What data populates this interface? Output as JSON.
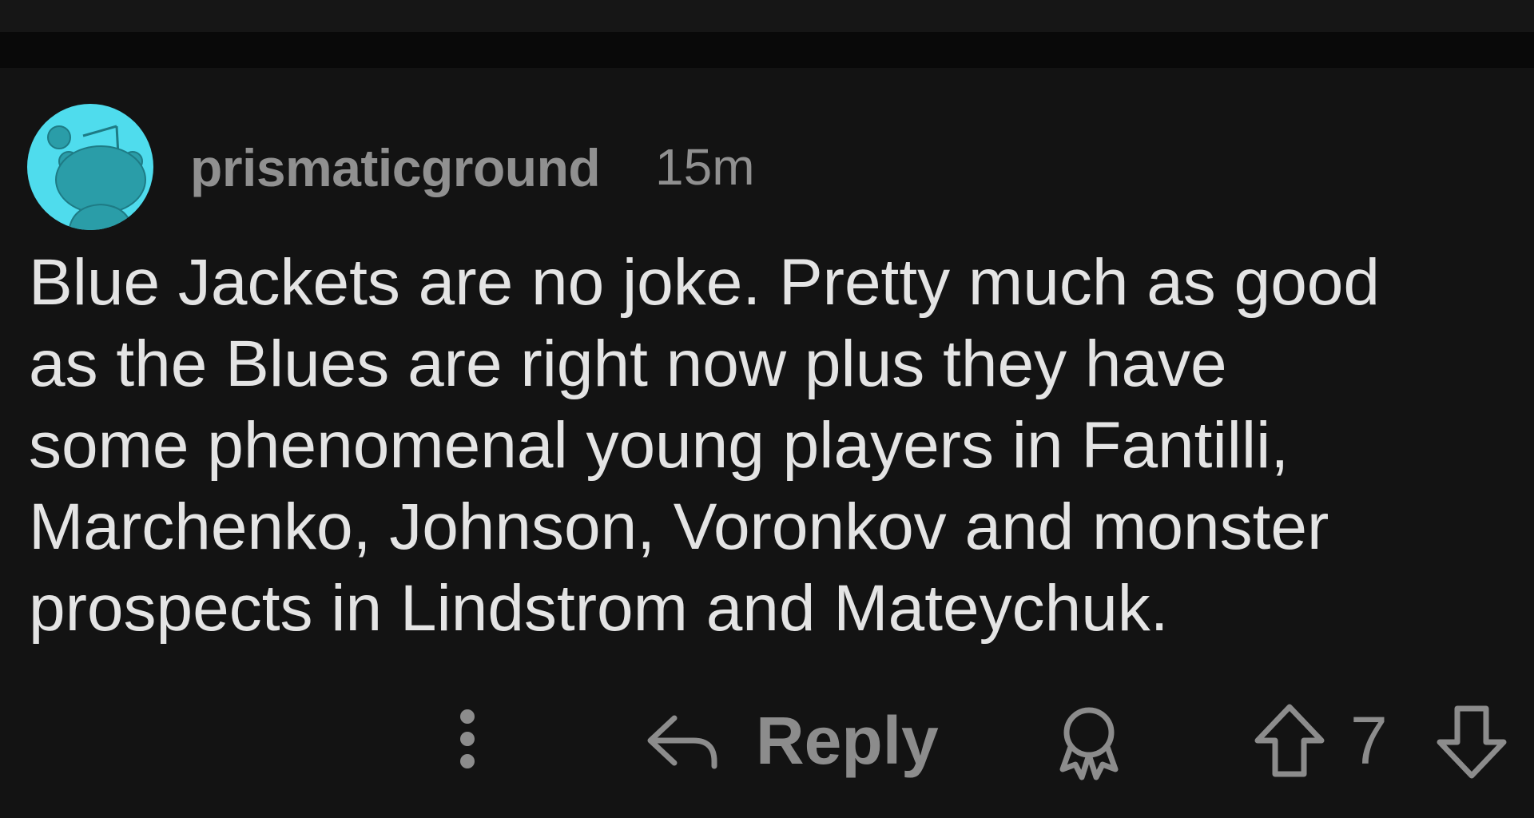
{
  "comment": {
    "username": "prismaticground",
    "timestamp": "15m",
    "body_lines": [
      "Blue Jackets are no joke. Pretty much as good",
      "as the Blues are right now plus they have",
      "some phenomenal young players in Fantilli,",
      "Marchenko, Johnson, Voronkov and monster",
      "prospects in Lindstrom and Mateychuk."
    ],
    "avatar_icon": "snoo-avatar-icon"
  },
  "actions": {
    "more_icon": "vertical-ellipsis-icon",
    "reply_icon": "reply-arrow-icon",
    "reply_label": "Reply",
    "award_icon": "award-icon",
    "upvote_icon": "upvote-arrow-icon",
    "vote_count": "7",
    "downvote_icon": "downvote-arrow-icon"
  },
  "colors": {
    "background": "#131313",
    "top_bar": "#090909",
    "avatar_bg": "#4fdced",
    "avatar_figure": "#2a9da8",
    "text_primary": "#e4e4e4",
    "text_secondary": "#909090"
  }
}
